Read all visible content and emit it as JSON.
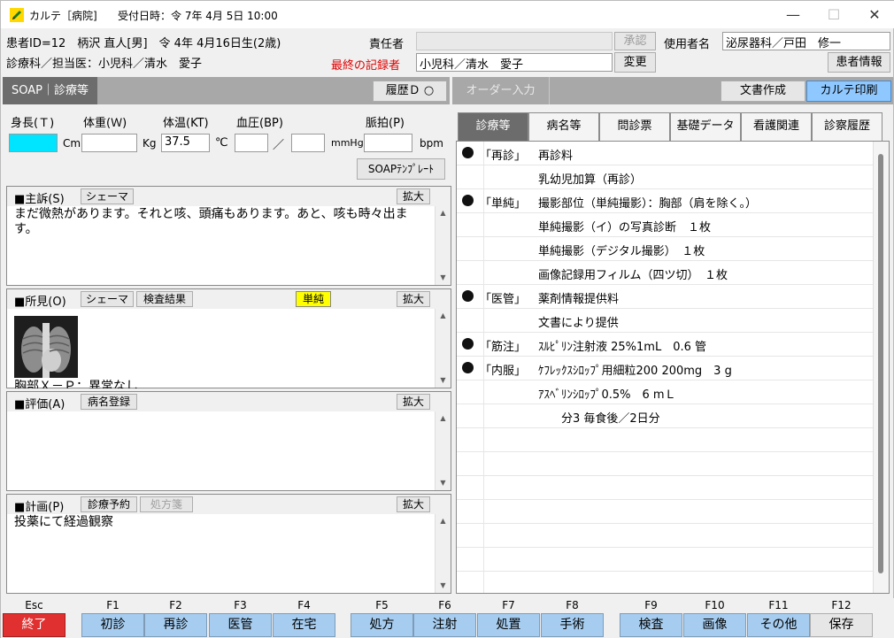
{
  "window": {
    "app_title": "カルテ［病院]",
    "reception": "受付日時：令 7年 4月 5日 10:00",
    "minimize": "—",
    "maximize": "☐",
    "close": "✕"
  },
  "patient": {
    "id_line": "患者ID=12　柄沢 直人[男]　令 4年 4月16日生(2歳)",
    "dept_line": "診療科／担当医：小児科／清水　愛子"
  },
  "header": {
    "responsible_label": "責任者",
    "responsible_value": "",
    "approve_btn": "承認",
    "user_label": "使用者名",
    "user_value": "泌尿器科／戸田　修一",
    "last_recorder_label": "最終の記録者",
    "last_recorder_value": "小児科／清水　愛子",
    "change_btn": "変更",
    "patient_info_btn": "患者情報"
  },
  "colors": {
    "last_recorder": "#e00000",
    "active_input": "#00e5ff",
    "fn_key": "#a6cdf0",
    "esc_key": "#e03030",
    "highlight_badge": "#ffff00"
  },
  "left": {
    "tab": "SOAP｜診療等",
    "history_btn": "履歴Ｄ ○",
    "vitals": {
      "height_label": "身長(Ｔ)",
      "weight_label": "体重(Ｗ)",
      "temp_label": "体温(KT)",
      "bp_label": "血圧(BP)",
      "pulse_label": "脈拍(P)",
      "height_value": "",
      "weight_value": "",
      "temp_value": "37.5",
      "bp_high": "",
      "bp_low": "",
      "pulse_value": "",
      "height_unit": "Cm",
      "weight_unit": "Kg",
      "temp_unit": "℃",
      "bp_sep": "／",
      "bp_unit": "mmHg",
      "pulse_unit": "bpm"
    },
    "soap_template_btn": "SOAPﾃﾝﾌﾟﾚｰﾄ",
    "s": {
      "title": "■主訴(S)",
      "schema_btn": "シェーマ",
      "expand_btn": "拡大",
      "text": "まだ微熱があります。それと咳、頭痛もあります。あと、咳も時々出ます。"
    },
    "o": {
      "title": "■所見(O)",
      "schema_btn": "シェーマ",
      "exam_btn": "検査結果",
      "badge": "単純",
      "expand_btn": "拡大",
      "text": "胸部Ｘ－Ｐ：異常なし"
    },
    "a": {
      "title": "■評価(A)",
      "disease_btn": "病名登録",
      "expand_btn": "拡大",
      "text": ""
    },
    "p": {
      "title": "■計画(P)",
      "appointment_btn": "診療予約",
      "prescription_btn": "処方箋",
      "expand_btn": "拡大",
      "text": "投薬にて経過観察"
    }
  },
  "right": {
    "order_input": "オーダー入力",
    "doc_btn": "文書作成",
    "print_btn": "カルテ印刷",
    "tabs": [
      "診療等",
      "病名等",
      "問診票",
      "基礎データ",
      "看護関連",
      "診察履歴"
    ],
    "orders": [
      {
        "bullet": true,
        "cat": "「再診」",
        "item": "再診料"
      },
      {
        "bullet": false,
        "cat": "",
        "item": "乳幼児加算（再診）"
      },
      {
        "bullet": true,
        "cat": "「単純」",
        "item": "撮影部位（単純撮影）：胸部（肩を除く。）"
      },
      {
        "bullet": false,
        "cat": "",
        "item": "単純撮影（イ）の写真診断　１枚"
      },
      {
        "bullet": false,
        "cat": "",
        "item": "単純撮影（デジタル撮影）　１枚"
      },
      {
        "bullet": false,
        "cat": "",
        "item": "画像記録用フィルム（四ツ切）　１枚"
      },
      {
        "bullet": true,
        "cat": "「医管」",
        "item": "薬剤情報提供料"
      },
      {
        "bullet": false,
        "cat": "",
        "item": "文書により提供"
      },
      {
        "bullet": true,
        "cat": "「筋注」",
        "item": "ｽﾙﾋﾟﾘﾝ注射液 25%1mL　0.6 管"
      },
      {
        "bullet": true,
        "cat": "「内服」",
        "item": "ｹﾌﾚｯｸｽｼﾛｯﾌﾟ用細粒200 200mg　3 g"
      },
      {
        "bullet": false,
        "cat": "",
        "item": "ｱｽﾍﾞﾘﾝｼﾛｯﾌﾟ0.5%　6 mＬ"
      },
      {
        "bullet": false,
        "cat": "",
        "item": "　　分3 毎食後／2日分"
      }
    ]
  },
  "fnkeys": [
    {
      "key": "Esc",
      "label": "終了"
    },
    {
      "key": "F1",
      "label": "初診"
    },
    {
      "key": "F2",
      "label": "再診"
    },
    {
      "key": "F3",
      "label": "医管"
    },
    {
      "key": "F4",
      "label": "在宅"
    },
    {
      "key": "F5",
      "label": "処方"
    },
    {
      "key": "F6",
      "label": "注射"
    },
    {
      "key": "F7",
      "label": "処置"
    },
    {
      "key": "F8",
      "label": "手術"
    },
    {
      "key": "F9",
      "label": "検査"
    },
    {
      "key": "F10",
      "label": "画像"
    },
    {
      "key": "F11",
      "label": "その他"
    },
    {
      "key": "F12",
      "label": "保存"
    }
  ]
}
